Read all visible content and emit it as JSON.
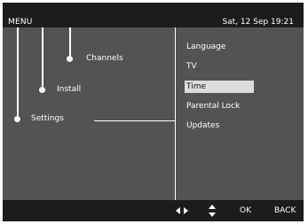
{
  "header": {
    "title": "MENU",
    "datetime": "Sat, 12 Sep 19:21"
  },
  "menu_tree": {
    "items": [
      {
        "label": "Channels"
      },
      {
        "label": "Install"
      },
      {
        "label": "Settings",
        "active": true
      }
    ]
  },
  "submenu": {
    "items": [
      {
        "label": "Language",
        "selected": false
      },
      {
        "label": "TV",
        "selected": false
      },
      {
        "label": "Time",
        "selected": true
      },
      {
        "label": "Parental Lock",
        "selected": false
      },
      {
        "label": "Updates",
        "selected": false
      }
    ]
  },
  "footer": {
    "nav_icons": [
      "left-right-arrows-icon",
      "up-down-arrows-icon"
    ],
    "ok_label": "OK",
    "back_label": "BACK"
  },
  "colors": {
    "screen_background": "#535353",
    "bar_background": "#1c1c1c",
    "selection_highlight": "#dcdcdc",
    "foreground": "#ffffff"
  }
}
